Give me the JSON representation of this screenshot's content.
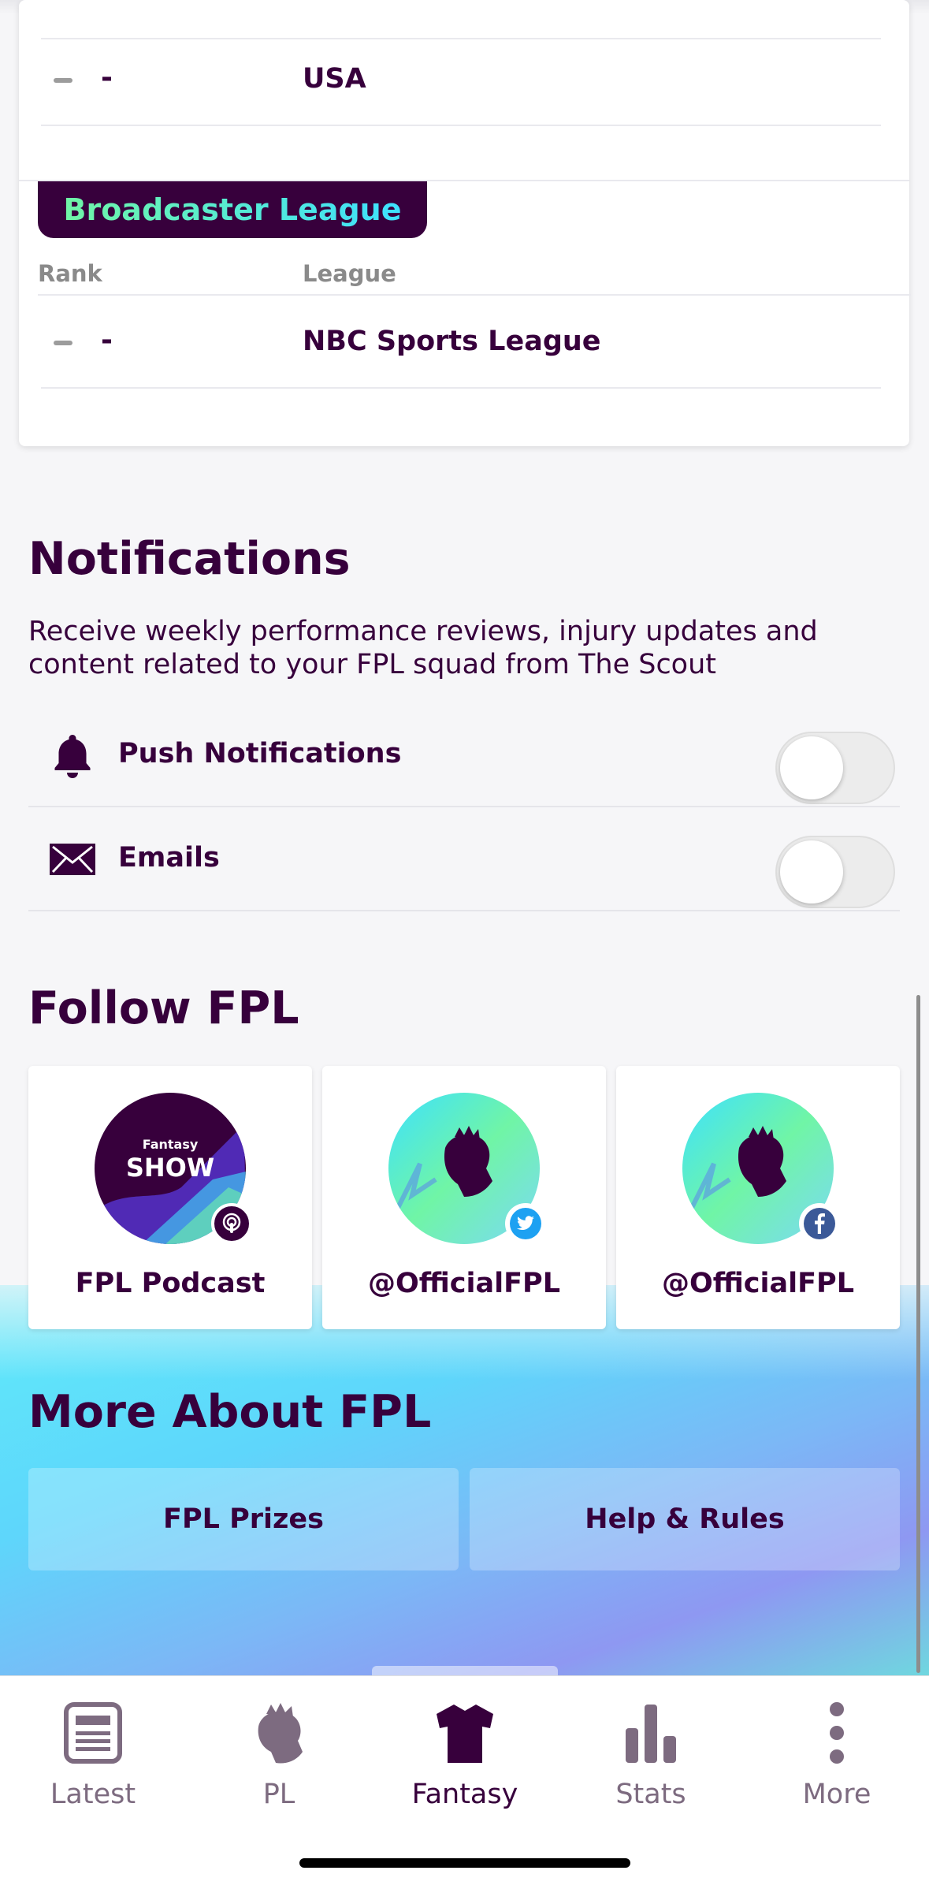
{
  "leagues": {
    "country_row": {
      "rank": "-",
      "name": "USA"
    },
    "broadcaster": {
      "header": "Broadcaster League",
      "col_rank": "Rank",
      "col_league": "League",
      "row": {
        "rank": "-",
        "name": "NBC Sports League"
      }
    }
  },
  "notifications": {
    "title": "Notifications",
    "description": "Receive weekly performance reviews, injury updates and content related to your FPL squad from The Scout",
    "items": [
      {
        "label": "Push Notifications",
        "icon": "bell-icon",
        "enabled": false
      },
      {
        "label": "Emails",
        "icon": "envelope-icon",
        "enabled": false
      }
    ]
  },
  "follow": {
    "title": "Follow FPL",
    "cards": [
      {
        "caption": "FPL Podcast",
        "avatar_small": "Fantasy",
        "avatar_big": "SHOW",
        "badge": "podcast-icon"
      },
      {
        "caption": "@OfficialFPL",
        "badge": "twitter-icon"
      },
      {
        "caption": "@OfficialFPL",
        "badge": "facebook-icon"
      }
    ]
  },
  "more_about": {
    "title": "More About FPL",
    "buttons": [
      "FPL Prizes",
      "Help & Rules"
    ]
  },
  "tabbar": {
    "tabs": [
      {
        "label": "Latest",
        "icon": "news-icon"
      },
      {
        "label": "PL",
        "icon": "lion-icon"
      },
      {
        "label": "Fantasy",
        "icon": "shirt-icon",
        "active": true
      },
      {
        "label": "Stats",
        "icon": "bar-chart-icon"
      },
      {
        "label": "More",
        "icon": "more-vertical-icon"
      }
    ]
  },
  "colors": {
    "brand_purple": "#37003c",
    "brand_green": "#70f5a6",
    "brand_cyan": "#3de1ff"
  }
}
